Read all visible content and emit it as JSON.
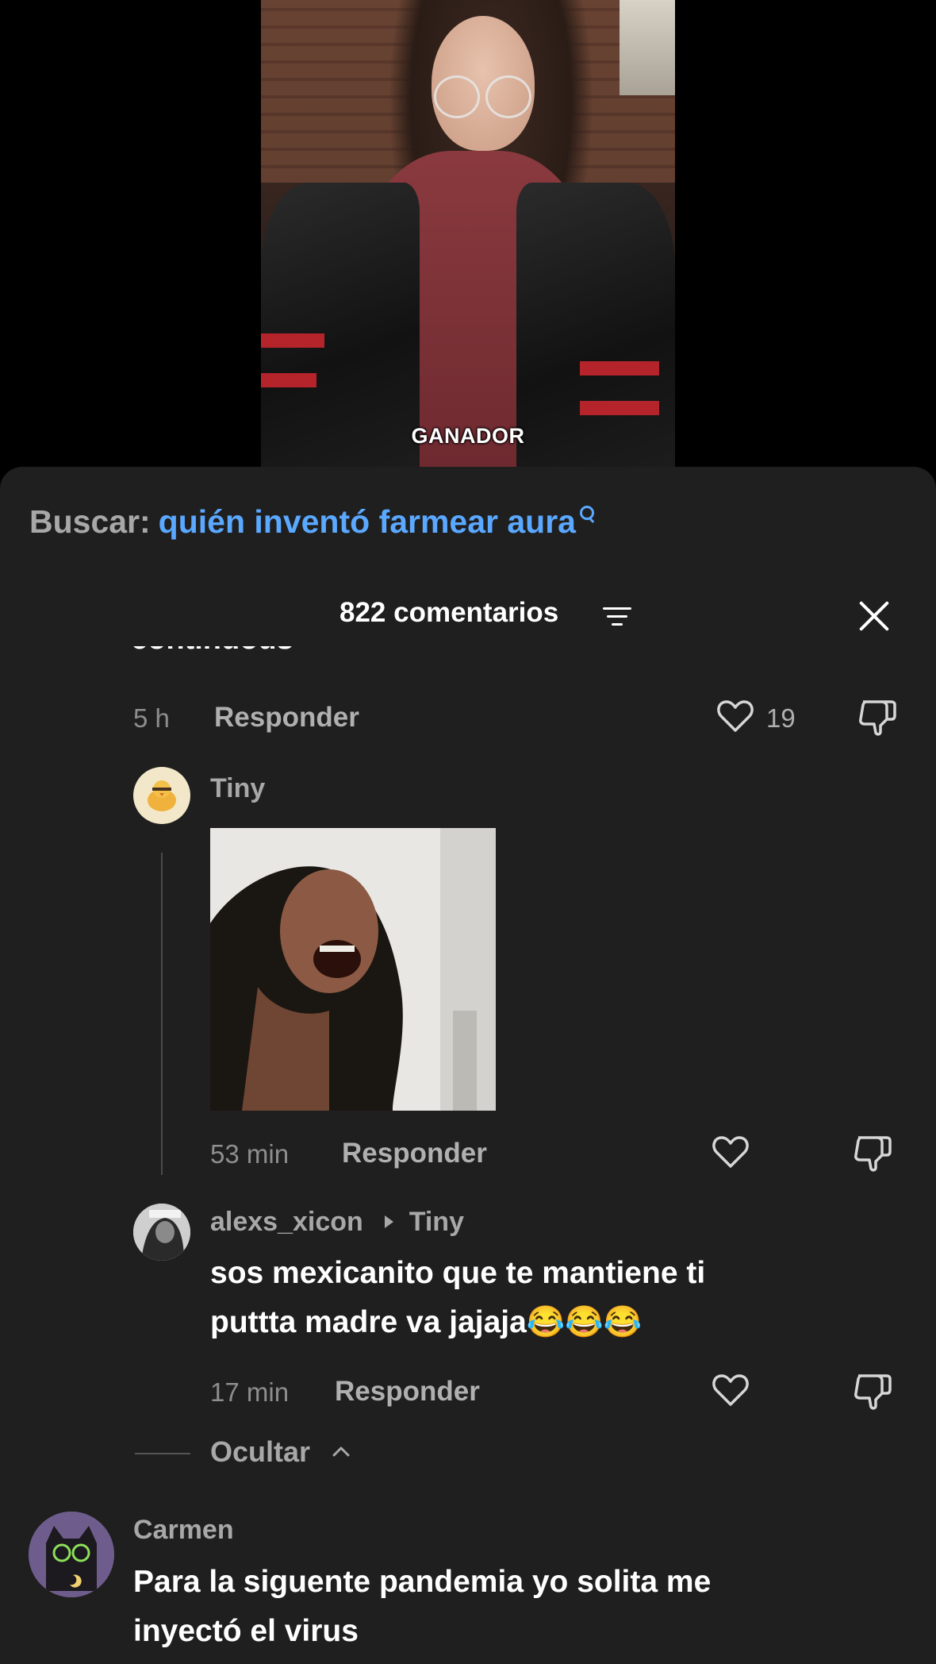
{
  "video": {
    "caption": "GANADOR"
  },
  "search": {
    "prefix": "Buscar:",
    "query": "quién inventó farmear aura",
    "icon": "search-icon"
  },
  "header": {
    "comment_count": "822 comentarios",
    "filter_icon": "filter-sort-icon",
    "close_icon": "close-icon"
  },
  "comments": [
    {
      "time": "5 h",
      "reply_label": "Responder",
      "likes": "19"
    },
    {
      "username": "Tiny",
      "attachment": "gif",
      "time": "53 min",
      "reply_label": "Responder"
    },
    {
      "username": "alexs_xicon",
      "reply_to": "Tiny",
      "text_line1": "sos mexicanito que te mantiene ti",
      "text_line2": "puttta madre va jajaja😂😂😂",
      "time": "17 min",
      "reply_label": "Responder"
    },
    {
      "username": "Carmen",
      "text_line1": "Para la siguente pandemia yo solita me",
      "text_line2": "inyectó el virus"
    }
  ],
  "hide_replies": {
    "label": "Ocultar"
  },
  "colors": {
    "sheet_bg": "#1f1f1f",
    "accent_link": "#5aa8ff",
    "muted_text": "#a8a8a8"
  }
}
